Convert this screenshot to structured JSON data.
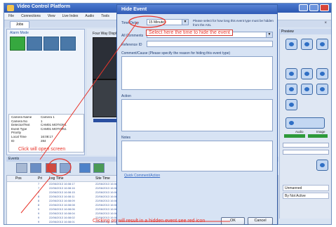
{
  "app": {
    "title": "Video Control Platform",
    "menu": [
      "File",
      "Connections",
      "View",
      "Live Index",
      "Audio",
      "Tools",
      "He"
    ],
    "tab": "Jobs"
  },
  "left": {
    "section_label": "Alarm Mode",
    "properties": [
      {
        "k": "Camera Name",
        "v": "Camera 1"
      },
      {
        "k": "Camera No",
        "v": "1"
      },
      {
        "k": "Detector/Text",
        "v": "CAM01 MOTION1"
      },
      {
        "k": "Event Type",
        "v": "CAM01 MOTION1"
      },
      {
        "k": "Priority",
        "v": ""
      },
      {
        "k": "Local Time",
        "v": "16:08:17"
      },
      {
        "k": "ID",
        "v": "284"
      }
    ]
  },
  "video": {
    "title": "Four Way Display"
  },
  "events": {
    "label": "Events",
    "columns": [
      "Pos",
      "Pri",
      "Log Time",
      "Site Time"
    ],
    "rows": [
      {
        "pos": "",
        "pri": "7",
        "log": "22/06/2013 16:08:17",
        "site": "22/06/2013 16:08"
      },
      {
        "pos": "",
        "pri": "7",
        "log": "22/06/2013 16:08:16",
        "site": "22/06/2013 16:08"
      },
      {
        "pos": "",
        "pri": "7",
        "log": "22/06/2013 16:08:15",
        "site": "22/06/2013 16:08"
      },
      {
        "pos": "",
        "pri": "8",
        "log": "22/06/2013 16:08:11",
        "site": "22/06/2013 16:08"
      },
      {
        "pos": "",
        "pri": "8",
        "log": "22/06/2013 16:08:09",
        "site": "22/06/2013 16:08"
      },
      {
        "pos": "",
        "pri": "8",
        "log": "22/06/2013 16:08:08",
        "site": "22/06/2013 16:08"
      },
      {
        "pos": "",
        "pri": "9",
        "log": "22/06/2013 16:08:06",
        "site": "22/06/2013 16:08"
      },
      {
        "pos": "",
        "pri": "9",
        "log": "22/06/2013 16:08:04",
        "site": "22/06/2013 16:08"
      },
      {
        "pos": "",
        "pri": "9",
        "log": "22/06/2013 16:08:02",
        "site": "22/06/2013 16:08"
      },
      {
        "pos": "",
        "pri": "9",
        "log": "22/06/2013 16:08:01",
        "site": "22/06/2013 16:08"
      }
    ]
  },
  "right": {
    "header": "Preview",
    "audio_label": "Audio",
    "image_label": "Image",
    "field_1": "Unmanned",
    "field_2": "By Not Active"
  },
  "dialog": {
    "title": "Hide Event",
    "time_delay_label": "Time Delay",
    "time_delay_value": "15 Minutes",
    "time_delay_hint": "Please select for how long this event type must be hidden from the ASL",
    "all_comments_label": "All Comments",
    "reference_label": "Reference ID",
    "comment_cause_label": "Comment/Cause (Please specify the reason for hiding this event type)",
    "action_label": "Action",
    "notes_label": "Notes",
    "quick_link": "Quick Comment/Action",
    "ok_label": "OK",
    "cancel_label": "Cancel"
  },
  "callouts": {
    "select_time": "Select here the time to hide the event",
    "click_open": "Click will open screen",
    "click_result": "Clicking on will result in a hidden event see red icon"
  }
}
